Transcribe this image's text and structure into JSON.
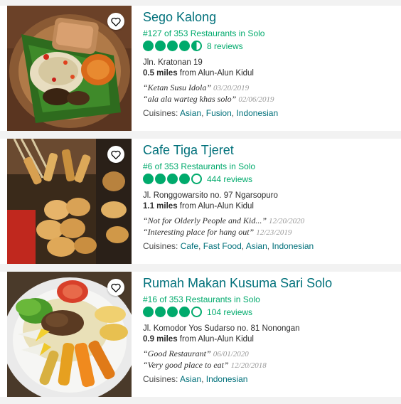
{
  "colors": {
    "brand_green": "#00aa6c",
    "title_teal": "#00707a"
  },
  "icons": {
    "save": "heart-icon"
  },
  "restaurants": [
    {
      "name": "Sego Kalong",
      "rank": "#127 of 353 Restaurants in Solo",
      "rating": 4.5,
      "reviews": "8 reviews",
      "address": "Jln. Kratonan 19",
      "distance_value": "0.5 miles",
      "distance_rest": " from Alun-Alun Kidul",
      "review1": {
        "quote": "“Ketan Susu Idola”",
        "date": "03/20/2019"
      },
      "review2": {
        "quote": "“ala ala warteg khas solo”",
        "date": "02/06/2019"
      },
      "cuisines_label": "Cuisines: ",
      "cuisines": [
        "Asian",
        "Fusion",
        "Indonesian"
      ]
    },
    {
      "name": "Cafe Tiga Tjeret",
      "rank": "#6 of 353 Restaurants in Solo",
      "rating": 4,
      "reviews": "444 reviews",
      "address": "Jl. Ronggowarsito no. 97 Ngarsopuro",
      "distance_value": "1.1 miles",
      "distance_rest": " from Alun-Alun Kidul",
      "review1": {
        "quote": "“Not for Olderly People and Kid...”",
        "date": "12/20/2020"
      },
      "review2": {
        "quote": "“Interesting place for hang out”",
        "date": "12/23/2019"
      },
      "cuisines_label": "Cuisines: ",
      "cuisines": [
        "Cafe",
        "Fast Food",
        "Asian",
        "Indonesian"
      ]
    },
    {
      "name": "Rumah Makan Kusuma Sari Solo",
      "rank": "#16 of 353 Restaurants in Solo",
      "rating": 4,
      "reviews": "104 reviews",
      "address": "Jl. Komodor Yos Sudarso no. 81 Nonongan",
      "distance_value": "0.9 miles",
      "distance_rest": " from Alun-Alun Kidul",
      "review1": {
        "quote": "“Good Restaurant”",
        "date": "06/01/2020"
      },
      "review2": {
        "quote": "“Very good place to eat”",
        "date": "12/20/2018"
      },
      "cuisines_label": "Cuisines: ",
      "cuisines": [
        "Asian",
        "Indonesian"
      ]
    }
  ]
}
